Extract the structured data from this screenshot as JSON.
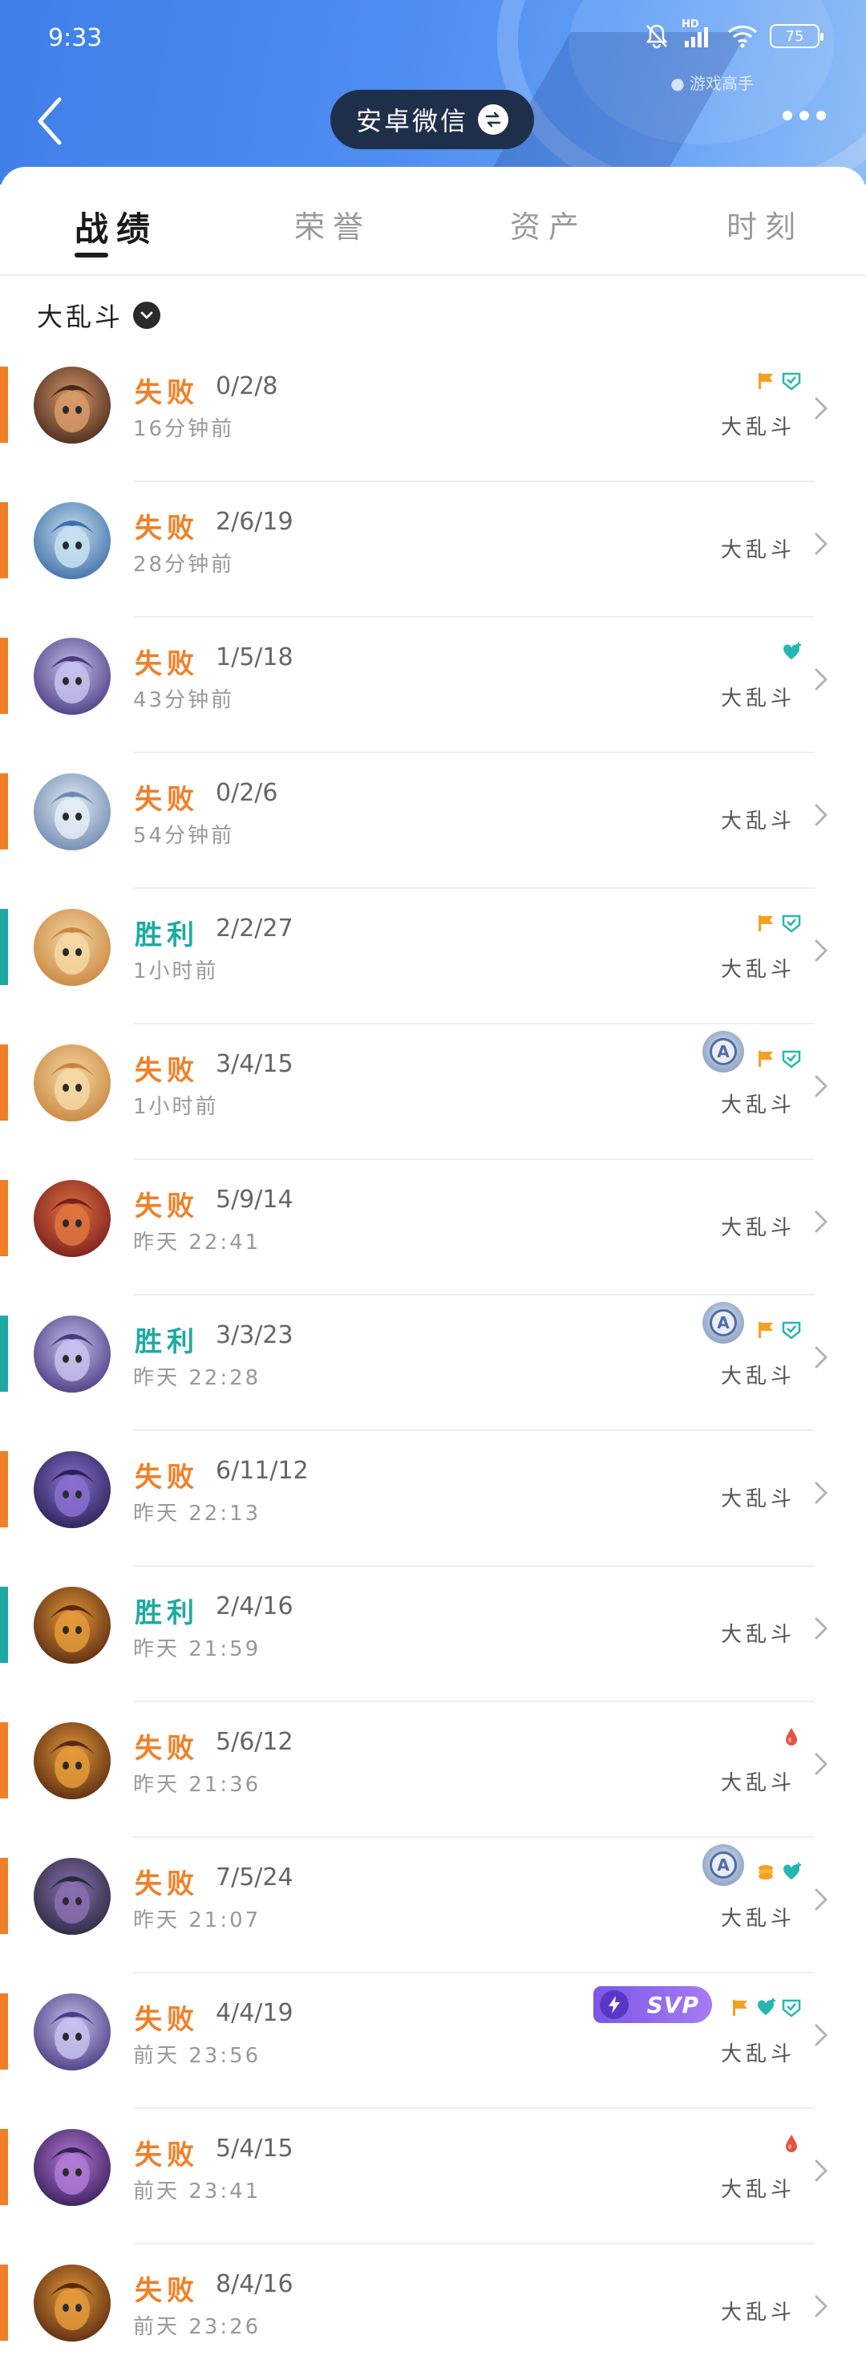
{
  "status_bar": {
    "time": "9:33",
    "battery": "75",
    "signal_label": "HD",
    "watermark": "● 游戏高手"
  },
  "header": {
    "account_name": "安卓微信"
  },
  "tabs": [
    {
      "label": "战绩",
      "active": true
    },
    {
      "label": "荣誉",
      "active": false
    },
    {
      "label": "资产",
      "active": false
    },
    {
      "label": "时刻",
      "active": false
    }
  ],
  "filter": {
    "label": "大乱斗"
  },
  "colors": {
    "loss": "#f08028",
    "win": "#1eaaa3",
    "header": "#4d8cf0"
  },
  "matches": [
    {
      "result": "失败",
      "outcome": "loss",
      "kda": "0/2/8",
      "time": "16分钟前",
      "mode": "大乱斗",
      "badges": [
        "flag-icon",
        "shield-icon"
      ],
      "medal": false,
      "svp": false
    },
    {
      "result": "失败",
      "outcome": "loss",
      "kda": "2/6/19",
      "time": "28分钟前",
      "mode": "大乱斗",
      "badges": [],
      "medal": false,
      "svp": false
    },
    {
      "result": "失败",
      "outcome": "loss",
      "kda": "1/5/18",
      "time": "43分钟前",
      "mode": "大乱斗",
      "badges": [
        "heart-icon"
      ],
      "medal": false,
      "svp": false
    },
    {
      "result": "失败",
      "outcome": "loss",
      "kda": "0/2/6",
      "time": "54分钟前",
      "mode": "大乱斗",
      "badges": [],
      "medal": false,
      "svp": false
    },
    {
      "result": "胜利",
      "outcome": "win",
      "kda": "2/2/27",
      "time": "1小时前",
      "mode": "大乱斗",
      "badges": [
        "flag-icon",
        "shield-icon"
      ],
      "medal": false,
      "svp": false
    },
    {
      "result": "失败",
      "outcome": "loss",
      "kda": "3/4/15",
      "time": "1小时前",
      "mode": "大乱斗",
      "badges": [
        "flag-icon",
        "shield-icon"
      ],
      "medal": true,
      "svp": false
    },
    {
      "result": "失败",
      "outcome": "loss",
      "kda": "5/9/14",
      "time": "昨天 22:41",
      "mode": "大乱斗",
      "badges": [],
      "medal": false,
      "svp": false
    },
    {
      "result": "胜利",
      "outcome": "win",
      "kda": "3/3/23",
      "time": "昨天 22:28",
      "mode": "大乱斗",
      "badges": [
        "flag-icon",
        "shield-icon"
      ],
      "medal": true,
      "svp": false
    },
    {
      "result": "失败",
      "outcome": "loss",
      "kda": "6/11/12",
      "time": "昨天 22:13",
      "mode": "大乱斗",
      "badges": [],
      "medal": false,
      "svp": false
    },
    {
      "result": "胜利",
      "outcome": "win",
      "kda": "2/4/16",
      "time": "昨天 21:59",
      "mode": "大乱斗",
      "badges": [],
      "medal": false,
      "svp": false
    },
    {
      "result": "失败",
      "outcome": "loss",
      "kda": "5/6/12",
      "time": "昨天 21:36",
      "mode": "大乱斗",
      "badges": [
        "drop-icon"
      ],
      "medal": false,
      "svp": false
    },
    {
      "result": "失败",
      "outcome": "loss",
      "kda": "7/5/24",
      "time": "昨天 21:07",
      "mode": "大乱斗",
      "badges": [
        "coin-icon",
        "heart-icon"
      ],
      "medal": true,
      "svp": false
    },
    {
      "result": "失败",
      "outcome": "loss",
      "kda": "4/4/19",
      "time": "前天 23:56",
      "mode": "大乱斗",
      "badges": [
        "flag-icon",
        "heart-icon",
        "shield-icon"
      ],
      "medal": false,
      "svp": true,
      "svp_label": "SVP"
    },
    {
      "result": "失败",
      "outcome": "loss",
      "kda": "5/4/15",
      "time": "前天 23:41",
      "mode": "大乱斗",
      "badges": [
        "drop-icon"
      ],
      "medal": false,
      "svp": false
    },
    {
      "result": "失败",
      "outcome": "loss",
      "kda": "8/4/16",
      "time": "前天 23:26",
      "mode": "大乱斗",
      "badges": [],
      "medal": false,
      "svp": false
    }
  ]
}
